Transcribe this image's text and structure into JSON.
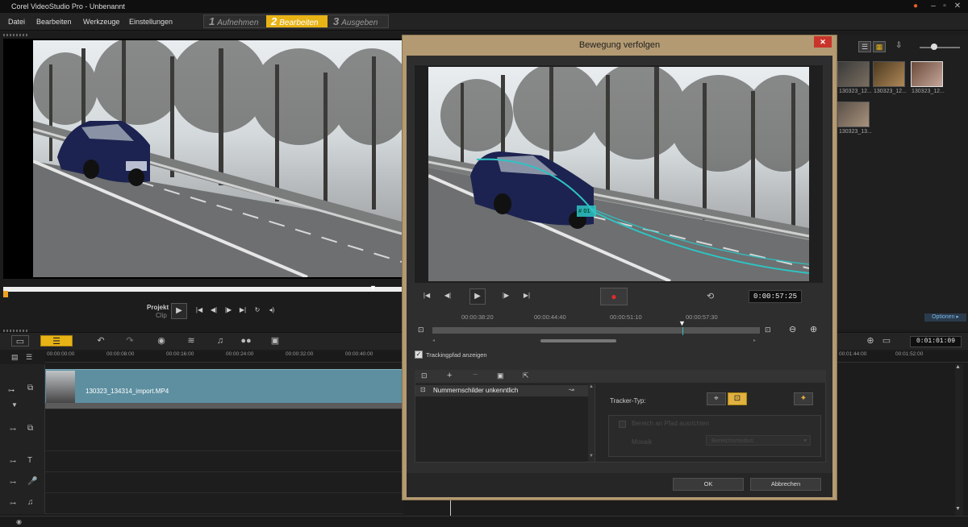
{
  "app": {
    "title": "Corel VideoStudio Pro - Unbenannt"
  },
  "menu": [
    "Datei",
    "Bearbeiten",
    "Werkzeuge",
    "Einstellungen"
  ],
  "steps": [
    {
      "num": "1",
      "label": "Aufnehmen",
      "active": false
    },
    {
      "num": "2",
      "label": "Bearbeiten",
      "active": true
    },
    {
      "num": "3",
      "label": "Ausgeben",
      "active": false
    }
  ],
  "player": {
    "project_label": "Projekt",
    "clip_label": "Clip"
  },
  "ruler": {
    "labels": [
      "00:00:00:00",
      "00:00:08:00",
      "00:00:16:00",
      "00:00:24:00",
      "00:00:32:00",
      "00:00:40:00"
    ],
    "right_labels": [
      "00:01:44:00",
      "00:01:52:00"
    ]
  },
  "timeline": {
    "clip_name": "130323_134314_import.MP4",
    "timecode": "0:01:01:09"
  },
  "library": {
    "thumbs": [
      "130323_12...",
      "130323_12...",
      "130323_12...",
      "130323_13..."
    ],
    "options": "Optionen ▸"
  },
  "dialog": {
    "title": "Bewegung verfolgen",
    "close": "✕",
    "timecode": "0:00:57:25",
    "ruler_labels": [
      "00:00:38:20",
      "00:00:44:40",
      "00:00:51:10",
      "00:00:57:30"
    ],
    "show_path_label": "Trackingpfad anzeigen",
    "show_path_checked": true,
    "tracker_item": "Nummernschilder unkenntlich",
    "tracker_type_label": "Tracker-Typ:",
    "disabled_option": "Bereich an Pfad ausrichten",
    "disabled_select": "Bereichsmodus",
    "disabled_label": "Mosaik",
    "ok": "OK",
    "cancel": "Abbrechen",
    "marker_label": "# 01",
    "path_color": "#2ec4c4"
  }
}
